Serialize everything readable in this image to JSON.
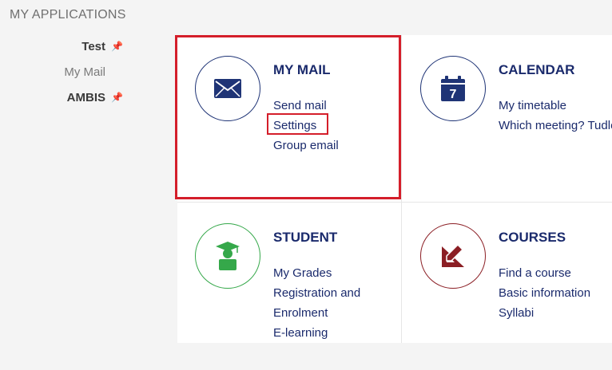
{
  "heading": "MY APPLICATIONS",
  "sidebar": {
    "items": [
      {
        "label": "Test",
        "pinned": true
      },
      {
        "label": "My Mail",
        "pinned": false
      },
      {
        "label": "AMBIS",
        "pinned": true
      }
    ]
  },
  "cards": [
    {
      "title": "MY MAIL",
      "icon": "envelope-icon",
      "links": [
        "Send mail",
        "Settings",
        "Group email"
      ]
    },
    {
      "title": "CALENDAR",
      "icon": "calendar-icon",
      "calendar_day": "7",
      "links": [
        "My timetable",
        "Which meeting? Tudle"
      ]
    },
    {
      "title": "STUDENT",
      "icon": "graduate-icon",
      "links": [
        "My Grades",
        "Registration and",
        "Enrolment",
        "E-learning"
      ]
    },
    {
      "title": "COURSES",
      "icon": "ruler-pencil-icon",
      "links": [
        "Find a course",
        "Basic information",
        "Syllabi"
      ]
    }
  ],
  "highlight_color": "#d41e2a",
  "colors": {
    "navy": "#1a2a6c",
    "green": "#35a84a",
    "maroon": "#8b1e24"
  }
}
